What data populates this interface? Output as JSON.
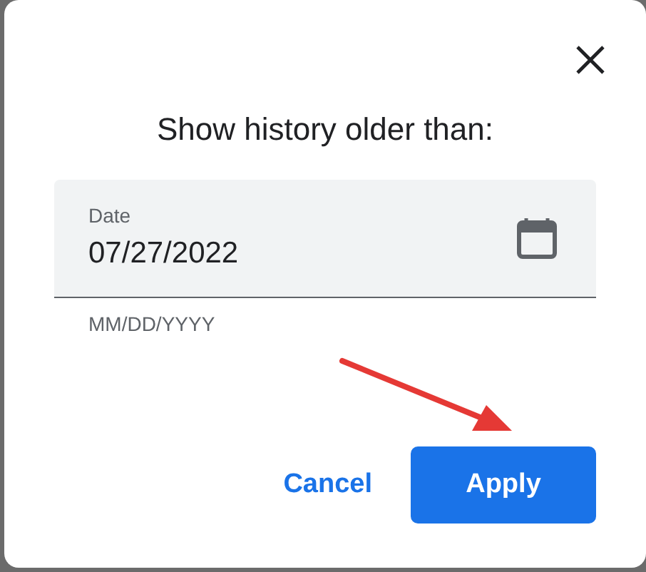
{
  "dialog": {
    "title": "Show history older than:",
    "date_field": {
      "label": "Date",
      "value": "07/27/2022",
      "helper": "MM/DD/YYYY"
    },
    "buttons": [
      {
        "label": "Cancel",
        "kind": "text"
      },
      {
        "label": "Apply",
        "kind": "primary"
      }
    ]
  }
}
